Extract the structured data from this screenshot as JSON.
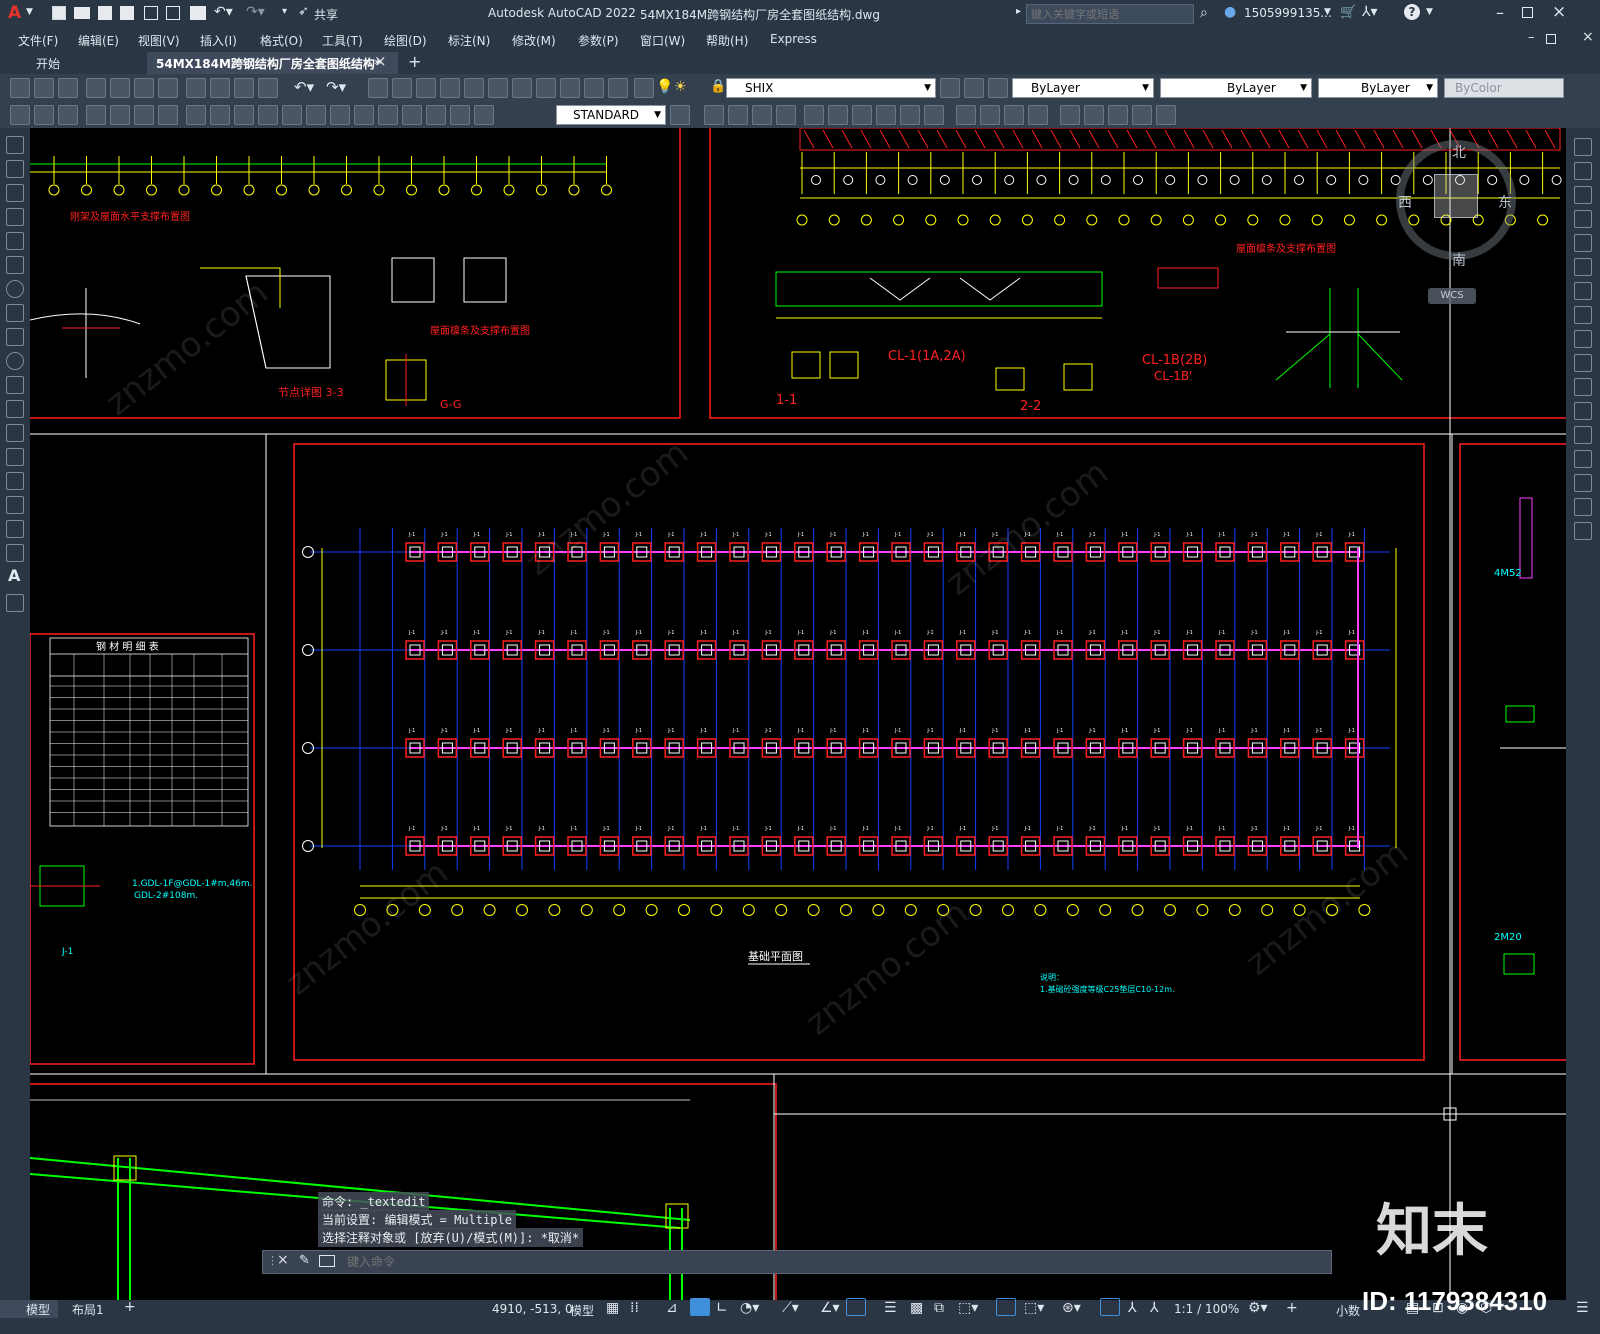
{
  "app": {
    "logo": "A",
    "title": "Autodesk AutoCAD 2022",
    "filename": "54MX184M跨钢结构厂房全套图纸结构.dwg",
    "share_label": "共享",
    "search_placeholder": "键入关键字或短语",
    "user": "1505999135..."
  },
  "menu": [
    "文件(F)",
    "编辑(E)",
    "视图(V)",
    "插入(I)",
    "格式(O)",
    "工具(T)",
    "绘图(D)",
    "标注(N)",
    "修改(M)",
    "参数(P)",
    "窗口(W)",
    "帮助(H)",
    "Express"
  ],
  "tabs": {
    "start": "开始",
    "document": "54MX184M跨钢结构厂房全套图纸结构*"
  },
  "toolbar": {
    "text_style": "SHIX",
    "layer_color": "ByLayer",
    "linetype": "ByLayer",
    "lineweight": "ByLayer",
    "plot_style": "ByColor",
    "dim_style": "STANDARD"
  },
  "viewcube": {
    "north": "北",
    "south": "南",
    "west": "西",
    "east": "东",
    "wcs": "WCS"
  },
  "drawing": {
    "title_foundation": "基础平面图",
    "table_title": "钢 材 明 细 表",
    "label_cl1": "CL-1(1A,2A)",
    "label_cl1b": "CL-1B(2B)",
    "label_cl1b2": "CL-1B'",
    "label_11": "1-1",
    "label_22": "2-2",
    "label_33": "节点详图 3-3",
    "label_gg": "G-G",
    "label_roof_brace": "屋面檩条及支撑布置图",
    "label_wall_brace": "刚架及屋面水平支撑布置图",
    "note_text1": "1.GDL-1F@GDL-1#m,46m.",
    "note_text2": "GDL-2#108m.",
    "label_j1": "J-1",
    "label_4m52": "4M52",
    "label_2m20": "2M20",
    "note_foundation": "说明：",
    "note_foundation2": "1.基础砼强度等级C25垫层C10-12m."
  },
  "command": {
    "line1": "命令: _textedit",
    "line2": "当前设置: 编辑模式 = Multiple",
    "line3": "选择注释对象或 [放弃(U)/模式(M)]: *取消*",
    "placeholder": "键入命令"
  },
  "status": {
    "model_tab": "模型",
    "layout_tab": "布局1",
    "coords": "4910, -513, 0",
    "model_label": "模型",
    "scale": "1:1 / 100%",
    "units": "小数"
  },
  "watermark": {
    "brand": "知末",
    "id_text": "ID: 1179384310"
  },
  "colors": {
    "red": "#ff2020",
    "yellow": "#ffff00",
    "green": "#00ff00",
    "cyan": "#00ffff",
    "blue": "#1040ff",
    "magenta": "#ff40ff",
    "white": "#ffffff"
  }
}
